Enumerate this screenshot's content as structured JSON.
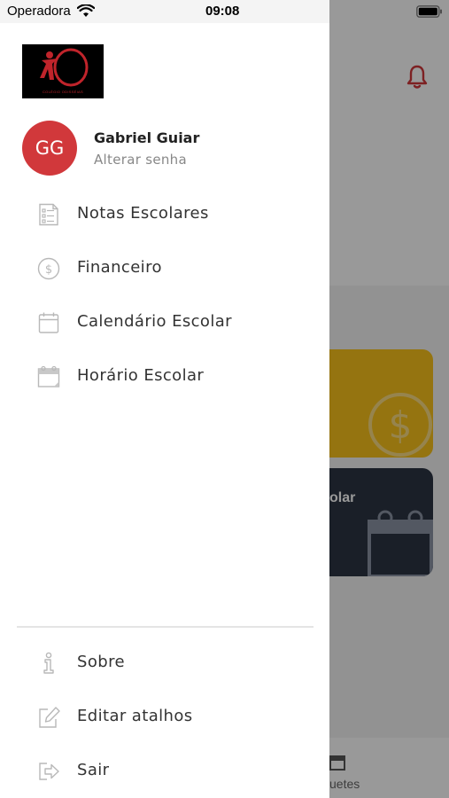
{
  "status_bar": {
    "carrier": "Operadora",
    "time": "09:08"
  },
  "drawer": {
    "logo_text": "COLÉGIO ODISSÉIAS",
    "user": {
      "initials": "GG",
      "name": "Gabriel Guiar",
      "subtitle": "Alterar senha",
      "avatar_color": "#d1383b"
    },
    "menu": [
      {
        "label": "Notas Escolares",
        "icon": "report-card-icon"
      },
      {
        "label": "Financeiro",
        "icon": "dollar-circle-icon"
      },
      {
        "label": "Calendário Escolar",
        "icon": "calendar-icon"
      },
      {
        "label": "Horário Escolar",
        "icon": "schedule-icon"
      }
    ],
    "footer_menu": [
      {
        "label": "Sobre",
        "icon": "info-icon"
      },
      {
        "label": "Editar atalhos",
        "icon": "edit-icon"
      },
      {
        "label": "Sair",
        "icon": "logout-icon"
      }
    ]
  },
  "background": {
    "card_dark_label": "olar",
    "bottom_tab_label": "uetes",
    "accent_yellow": "#f8c21c",
    "accent_dark": "#2c3444",
    "bell_color": "#d1383b"
  }
}
